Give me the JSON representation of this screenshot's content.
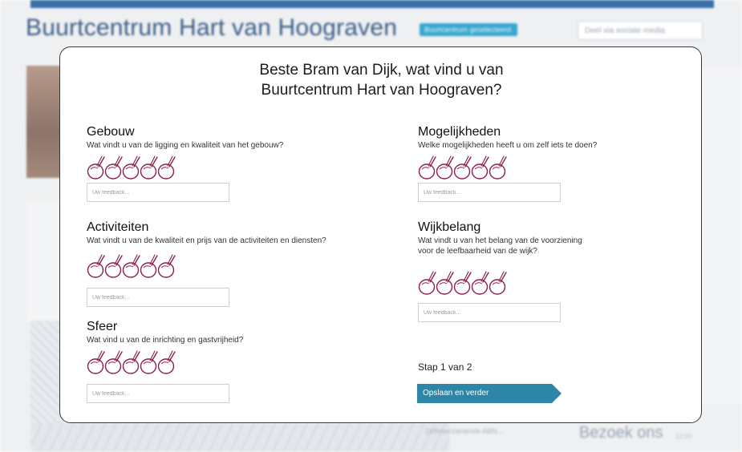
{
  "background": {
    "page_title": "Buurtcentrum Hart van Hoograven",
    "badge": "Buurtcentrum geselecteerd",
    "share_button": "Deel via sociale media",
    "bottom_dropdown": "Zelfvoorzienende ABN...",
    "visit_heading": "Bezoek ons",
    "visit_time": "12:00"
  },
  "modal": {
    "title_line1": "Beste Bram van Dijk, wat vind u van",
    "title_line2": "Buurtcentrum Hart van Hoograven?",
    "sections": [
      {
        "heading": "Gebouw",
        "question": "Wat vindt u van de ligging en kwaliteit van het gebouw?",
        "placeholder": "Uw feedback..."
      },
      {
        "heading": "Activiteiten",
        "question": "Wat vindt u van de kwaliteit  en prijs van de activiteiten en diensten?",
        "placeholder": "Uw feedback..."
      },
      {
        "heading": "Sfeer",
        "question": "Wat vind u van de inrichting en gastvrijheid?",
        "placeholder": "Uw feedback..."
      },
      {
        "heading": "Mogelijkheden",
        "question": "Welke mogelijkheden heeft u om zelf iets te doen?",
        "placeholder": "Uw feedback..."
      },
      {
        "heading": "Wijkbelang",
        "question_line1": "Wat vindt u van het belang van de voorziening",
        "question_line2": "voor de leefbaarheid van de wijk?",
        "placeholder": "Uw feedback..."
      }
    ],
    "step_label": "Stap 1 van 2",
    "next_button": "Opslaan en verder"
  },
  "colors": {
    "accent": "#2d86a8",
    "rating_icon": "#8b1e4f"
  },
  "icons": {
    "rating": "hand-drawn-rating-icon"
  }
}
